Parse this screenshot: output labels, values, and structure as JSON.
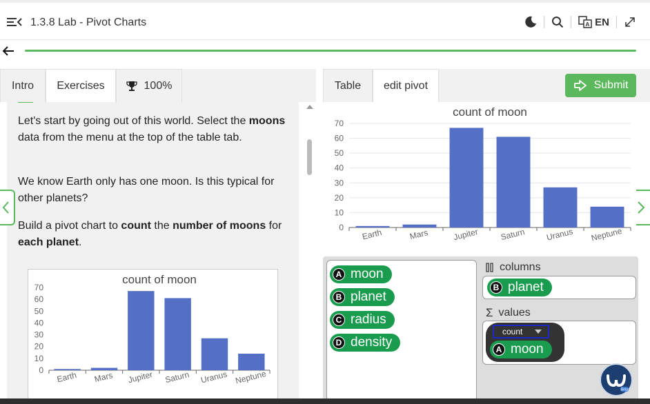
{
  "header": {
    "title": "1.3.8 Lab - Pivot Charts",
    "lang": "EN"
  },
  "left_tabs": [
    {
      "label": "Intro"
    },
    {
      "label": "Exercises"
    },
    {
      "label": "100%"
    }
  ],
  "instructions": {
    "p1_pre": "Let's start by going out of this world. Select the ",
    "p1_bold": "moons",
    "p1_post": " data from the menu at the top of the table tab.",
    "p2": "We know Earth only has one moon. Is this typical for other planets?",
    "p3_pre": "Build a pivot chart to ",
    "p3_b1": "count",
    "p3_mid1": " the ",
    "p3_b2": "number of moons",
    "p3_mid2": " for ",
    "p3_b3": "each planet",
    "p3_end": "."
  },
  "right_tabs": [
    {
      "label": "Table"
    },
    {
      "label": "edit pivot"
    }
  ],
  "submit_label": "Submit",
  "fields": [
    {
      "badge": "A",
      "label": "moon"
    },
    {
      "badge": "B",
      "label": "planet"
    },
    {
      "badge": "C",
      "label": "radius"
    },
    {
      "badge": "D",
      "label": "density"
    }
  ],
  "columns_zone": {
    "label": "columns",
    "field": {
      "badge": "B",
      "label": "planet"
    }
  },
  "values_zone": {
    "label": "values",
    "aggregate": "count",
    "field": {
      "badge": "A",
      "label": "moon"
    }
  },
  "bot_label": "Beta",
  "colors": {
    "accent": "#5cb85c",
    "pill": "#1a9c4e",
    "bar": "#5470c6"
  },
  "chart_data": [
    {
      "type": "bar",
      "title": "count of moon",
      "categories": [
        "Earth",
        "Mars",
        "Jupiter",
        "Saturn",
        "Uranus",
        "Neptune"
      ],
      "values": [
        1,
        2,
        67,
        61,
        27,
        14
      ],
      "ylim": [
        0,
        70
      ],
      "yticks": [
        0,
        10,
        20,
        30,
        40,
        50,
        60,
        70
      ],
      "grid": true
    },
    {
      "type": "bar",
      "title": "count of moon",
      "categories": [
        "Earth",
        "Mars",
        "Jupiter",
        "Saturn",
        "Uranus",
        "Neptune"
      ],
      "values": [
        1,
        2,
        67,
        61,
        27,
        14
      ],
      "ylim": [
        0,
        70
      ],
      "yticks": [
        0,
        10,
        20,
        30,
        40,
        50,
        60,
        70
      ],
      "grid": false
    }
  ]
}
